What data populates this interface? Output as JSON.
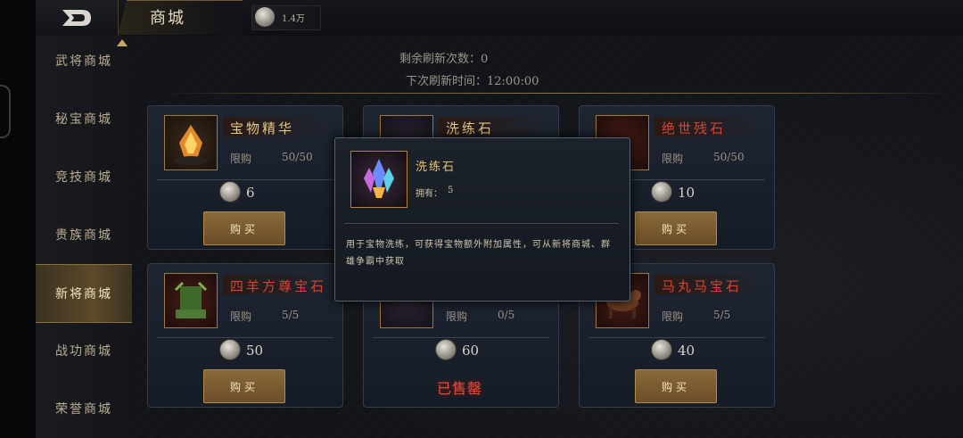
{
  "header": {
    "title": "商城",
    "currency_value": "1.4万",
    "back_icon": "back-arrow-icon"
  },
  "sidebar": {
    "items": [
      {
        "label": "武将商城"
      },
      {
        "label": "秘宝商城"
      },
      {
        "label": "竞技商城"
      },
      {
        "label": "贵族商城"
      },
      {
        "label": "新将商城"
      },
      {
        "label": "战功商城"
      },
      {
        "label": "荣誉商城"
      }
    ],
    "active_index": 4
  },
  "refresh": {
    "remaining_label": "剩余刷新次数：0",
    "next_label": "下次刷新时间：12:00:00"
  },
  "cards": [
    {
      "name": "宝物精华",
      "name_color": "gold",
      "limit_label": "限购",
      "limit": "50/50",
      "price": "6",
      "button": "购买",
      "sold_out": false
    },
    {
      "name": "洗练石",
      "name_color": "gold",
      "limit_label": "限购",
      "limit": "",
      "price": "",
      "button": "",
      "sold_out": false
    },
    {
      "name": "绝世残石",
      "name_color": "red",
      "limit_label": "限购",
      "limit": "50/50",
      "price": "10",
      "button": "购买",
      "sold_out": false
    },
    {
      "name": "四羊方尊宝石",
      "name_color": "red",
      "limit_label": "限购",
      "limit": "5/5",
      "price": "50",
      "button": "购买",
      "sold_out": false
    },
    {
      "name": "",
      "name_color": "red",
      "limit_label": "限购",
      "limit": "0/5",
      "price": "60",
      "button": "",
      "sold_out": true,
      "sold_out_label": "已售罄"
    },
    {
      "name": "马丸马宝石",
      "name_color": "red",
      "limit_label": "限购",
      "limit": "5/5",
      "price": "40",
      "button": "购买",
      "sold_out": false
    }
  ],
  "popup": {
    "name": "洗练石",
    "owned_label": "拥有：",
    "owned_value": "5",
    "description": "用于宝物洗练，可获得宝物额外附加属性，可从新将商城、群雄争霸中获取"
  },
  "colors": {
    "gold_text": "#e8c77a",
    "red_text": "#d44334",
    "button": "#7a5c30",
    "sold_out": "#e24a3a"
  }
}
